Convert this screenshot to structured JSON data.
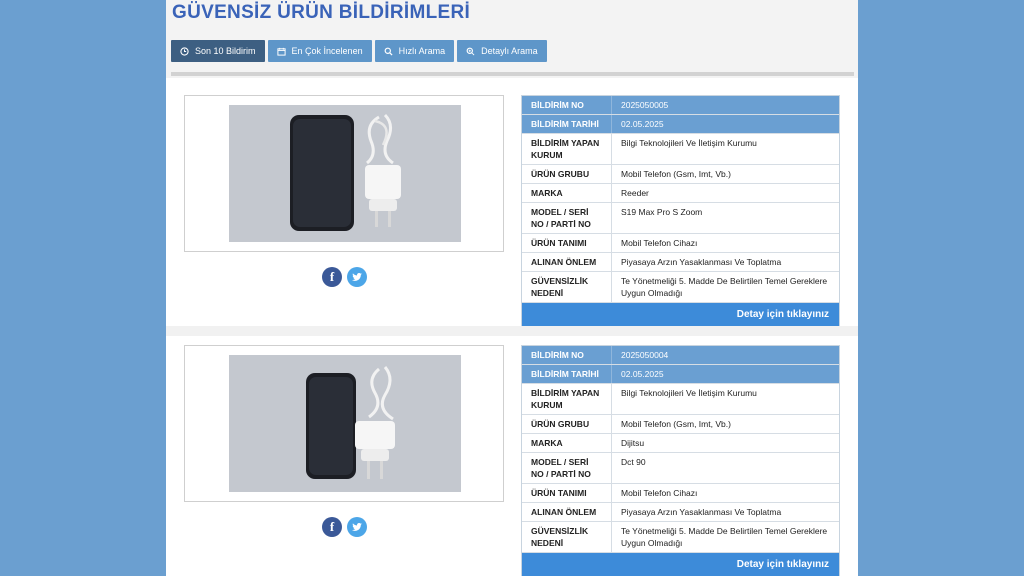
{
  "page": {
    "title": "GÜVENSİZ ÜRÜN BİLDİRİMLERİ"
  },
  "tabs": [
    {
      "label": "Son 10 Bildirim",
      "icon": "clock-icon",
      "active": true
    },
    {
      "label": "En Çok İncelenen",
      "icon": "calendar-icon",
      "active": false
    },
    {
      "label": "Hızlı Arama",
      "icon": "search-icon",
      "active": false
    },
    {
      "label": "Detaylı Arama",
      "icon": "zoom-search-icon",
      "active": false
    }
  ],
  "labels": {
    "bildirim_no": "BİLDİRİM NO",
    "bildirim_tarihi": "BİLDİRİM TARİHİ",
    "bildirim_yapan_kurum": "BİLDİRİM YAPAN KURUM",
    "urun_grubu": "ÜRÜN GRUBU",
    "marka": "MARKA",
    "model": "MODEL / SERİ NO / PARTİ NO",
    "urun_tanimi": "ÜRÜN TANIMI",
    "alinan_onlem": "ALINAN ÖNLEM",
    "guvensizlik_nedeni": "GÜVENSİZLİK NEDENİ",
    "detail_button": "Detay için tıklayınız"
  },
  "social": {
    "facebook": "f"
  },
  "notifications": [
    {
      "bildirim_no": "2025050005",
      "bildirim_tarihi": "02.05.2025",
      "bildirim_yapan_kurum": "Bilgi Teknolojileri Ve İletişim Kurumu",
      "urun_grubu": "Mobil Telefon (Gsm, Imt, Vb.)",
      "marka": "Reeder",
      "model": "S19 Max Pro S Zoom",
      "urun_tanimi": "Mobil Telefon Cihazı",
      "alinan_onlem": "Piyasaya Arzın Yasaklanması Ve Toplatma",
      "guvensizlik_nedeni": "Te Yönetmeliği 5. Madde De Belirtilen Temel Gereklere Uygun Olmadığı"
    },
    {
      "bildirim_no": "2025050004",
      "bildirim_tarihi": "02.05.2025",
      "bildirim_yapan_kurum": "Bilgi Teknolojileri Ve İletişim Kurumu",
      "urun_grubu": "Mobil Telefon (Gsm, Imt, Vb.)",
      "marka": "Dijitsu",
      "model": "Dct 90",
      "urun_tanimi": "Mobil Telefon Cihazı",
      "alinan_onlem": "Piyasaya Arzın Yasaklanması Ve Toplatma",
      "guvensizlik_nedeni": "Te Yönetmeliği 5. Madde De Belirtilen Temel Gereklere Uygun Olmadığı"
    }
  ],
  "colors": {
    "background": "#6b9fd0",
    "title": "#3a63b8",
    "tab": "#5e96c9",
    "tab_active": "#3d5f82",
    "header_row": "#6a9fd2",
    "detail_button": "#3d8bd9"
  }
}
